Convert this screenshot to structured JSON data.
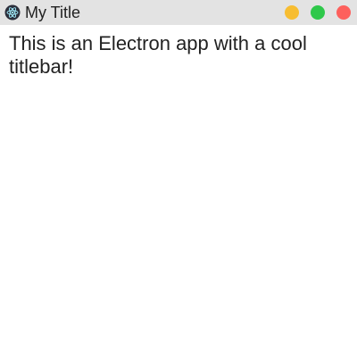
{
  "window": {
    "title": "My Title",
    "app_icon": "electron-icon"
  },
  "controls": {
    "minimize": {
      "icon": "minimize-icon",
      "color": "#f7bd31"
    },
    "maximize": {
      "icon": "maximize-icon",
      "color": "#2ec84a"
    },
    "close": {
      "icon": "close-icon",
      "color": "#fd605c"
    }
  },
  "titlebar_color": "#e3e3e3",
  "main": {
    "message": "This is an Electron app with a cool titlebar!"
  }
}
